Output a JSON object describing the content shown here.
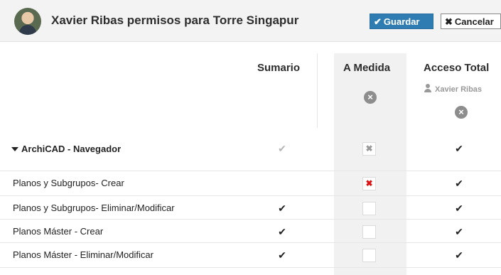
{
  "header": {
    "title": "Xavier Ribas permisos para Torre Singapur",
    "save_label": "Guardar",
    "cancel_label": "Cancelar",
    "save_icon": "✔",
    "cancel_icon": "✖"
  },
  "columns": {
    "sumario": "Sumario",
    "a_medida": "A Medida",
    "acceso_total": "Acceso Total",
    "acceso_user": "Xavier Ribas",
    "remove_icon": "×"
  },
  "group": {
    "label": "ArchiCAD - Navegador",
    "sumario": "✔",
    "medida": "✖",
    "total": "✔"
  },
  "rows": [
    {
      "label": "Planos y Subgrupos- Crear",
      "sumario": "",
      "medida": "✖",
      "total": "✔"
    },
    {
      "label": "Planos y Subgrupos- Eliminar/Modificar",
      "sumario": "✔",
      "medida": "",
      "total": "✔"
    },
    {
      "label": "Planos Máster - Crear",
      "sumario": "✔",
      "medida": "",
      "total": "✔"
    },
    {
      "label": "Planos Máster - Eliminar/Modificar",
      "sumario": "✔",
      "medida": "",
      "total": "✔"
    }
  ],
  "colors": {
    "accent": "#2f7cb3",
    "deny": "#dd1111"
  }
}
